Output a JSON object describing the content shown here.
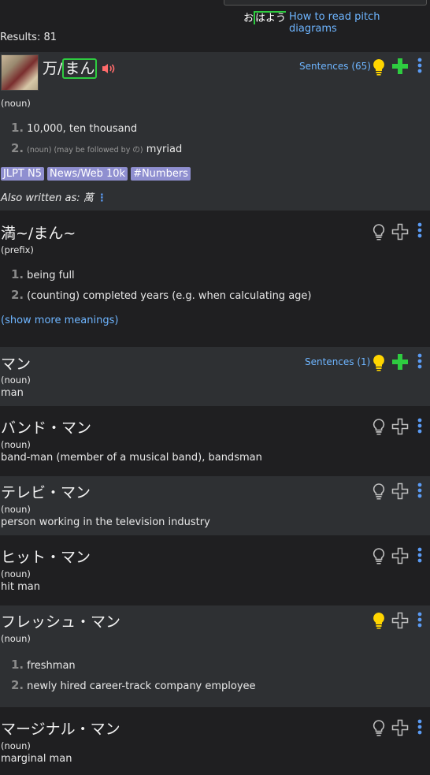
{
  "header": {
    "pitch_demo": {
      "pre": "お",
      "hi": "はよう"
    },
    "pitch_link": "How to read pitch diagrams"
  },
  "results": "Results: 81",
  "entries": [
    {
      "word_pre": "万/",
      "word_hi": "まん",
      "sentences": "Sentences (65)",
      "pos": "(noun)",
      "senses": [
        {
          "num": "1.",
          "text": "10,000, ten thousand"
        },
        {
          "num": "2.",
          "note": "(noun) (may be followed by の)",
          "text": "myriad"
        }
      ],
      "tags": [
        "JLPT N5",
        "News/Web 10k",
        "#Numbers"
      ],
      "also_label": "Also written as",
      "also_value": "萬"
    },
    {
      "word": "満~/まん~",
      "pos": "(prefix)",
      "senses": [
        {
          "num": "1.",
          "text": "being full"
        },
        {
          "num": "2.",
          "text": "(counting) completed years (e.g. when calculating age)"
        }
      ],
      "more": "(show more meanings)"
    },
    {
      "word": "マン",
      "sentences": "Sentences (1)",
      "pos": "(noun)",
      "gloss": "man"
    },
    {
      "word": "バンド・マン",
      "pos": "(noun)",
      "gloss": "band-man (member of a musical band), bandsman"
    },
    {
      "word": "テレビ・マン",
      "pos": "(noun)",
      "gloss": "person working in the television industry"
    },
    {
      "word": "ヒット・マン",
      "pos": "(noun)",
      "gloss": "hit man"
    },
    {
      "word": "フレッシュ・マン",
      "pos": "(noun)",
      "senses": [
        {
          "num": "1.",
          "text": "freshman"
        },
        {
          "num": "2.",
          "text": "newly hired career-track company employee"
        }
      ]
    },
    {
      "word": "マージナル・マン",
      "pos": "(noun)",
      "gloss": "marginal man"
    }
  ],
  "colors": {
    "accent_green": "#2ecc40",
    "link_blue": "#6eb5ff",
    "tag_purple": "#8f8fd0",
    "bulb_active": "#ffd500",
    "speaker_red": "#ff6b6b"
  },
  "icons": [
    "speaker-icon",
    "lightbulb-icon",
    "plus-icon",
    "more-dots-icon",
    "thumbnail-image"
  ]
}
